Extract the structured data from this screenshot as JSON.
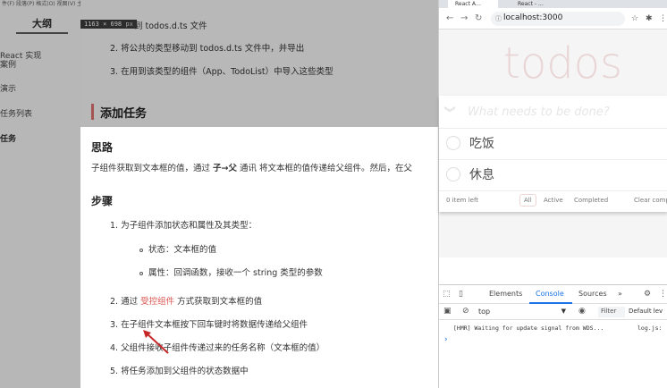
{
  "sidebar": {
    "menubar": "件(F)  段落(P)  格式(O)  视图(V)  主题(T)  帮助(H)",
    "title": "大纲",
    "items": [
      {
        "label": "React 实现"
      },
      {
        "label": "案例"
      },
      {
        "label": "演示"
      },
      {
        "label": "任务列表"
      },
      {
        "label": "任务"
      }
    ]
  },
  "doc": {
    "dimension_badge": {
      "size": "1163 × 698",
      "unit": "px"
    },
    "top_line": "到 todos.d.ts 文件",
    "list_top": [
      {
        "num": "2.",
        "text": "将公共的类型移动到 todos.d.ts 文件中，并导出"
      },
      {
        "num": "3.",
        "text": "在用到该类型的组件（App、TodoList）中导入这些类型"
      }
    ],
    "section_title": "添加任务",
    "idea_heading": "思路",
    "idea_text_pre": "子组件获取到文本框的值，通过 ",
    "idea_text_bold": "子→父",
    "idea_text_post": " 通讯 将文本框的值传递给父组件。然后，在父",
    "steps_heading": "步骤",
    "step1": {
      "num": "1.",
      "text": "为子组件添加状态和属性及其类型："
    },
    "step1_sub": [
      {
        "text": "状态：文本框的值"
      },
      {
        "text": "属性：回调函数，接收一个 string 类型的参数"
      }
    ],
    "step2": {
      "num": "2.",
      "pre": "通过 ",
      "link": "受控组件",
      "post": " 方式获取到文本框的值"
    },
    "step3": {
      "num": "3.",
      "text": "在子组件文本框按下回车键时将数据传递给父组件"
    },
    "step4": {
      "num": "4.",
      "text": "父组件接收子组件传递过来的任务名称（文本框的值）"
    },
    "step5": {
      "num": "5.",
      "text": "将任务添加到父组件的状态数据中"
    }
  },
  "browser": {
    "tabs": [
      {
        "label": "React A…"
      },
      {
        "label": "React - …"
      }
    ],
    "url": "localhost:3000",
    "app": {
      "title": "todos",
      "placeholder": "What needs to be done?",
      "items": [
        {
          "label": "吃饭"
        },
        {
          "label": "休息"
        }
      ],
      "footer": {
        "count": "0 item left",
        "filters": [
          {
            "label": "All",
            "selected": true
          },
          {
            "label": "Active",
            "selected": false
          },
          {
            "label": "Completed",
            "selected": false
          }
        ],
        "clear": "Clear comp"
      }
    }
  },
  "devtools": {
    "tabs": [
      {
        "label": "Elements"
      },
      {
        "label": "Console"
      },
      {
        "label": "Sources"
      },
      {
        "label": "»"
      }
    ],
    "context": "top",
    "filter_placeholder": "Filter",
    "levels": "Default lev",
    "console_message": "[HMR] Waiting for update signal from WDS...",
    "console_source": "log.js:",
    "prompt": "›"
  },
  "colors": {
    "accent": "#1a73e8",
    "section_bar": "#e57373",
    "todos_title": "#af2f2f",
    "sidebar_bg": "#b7b7b7"
  }
}
